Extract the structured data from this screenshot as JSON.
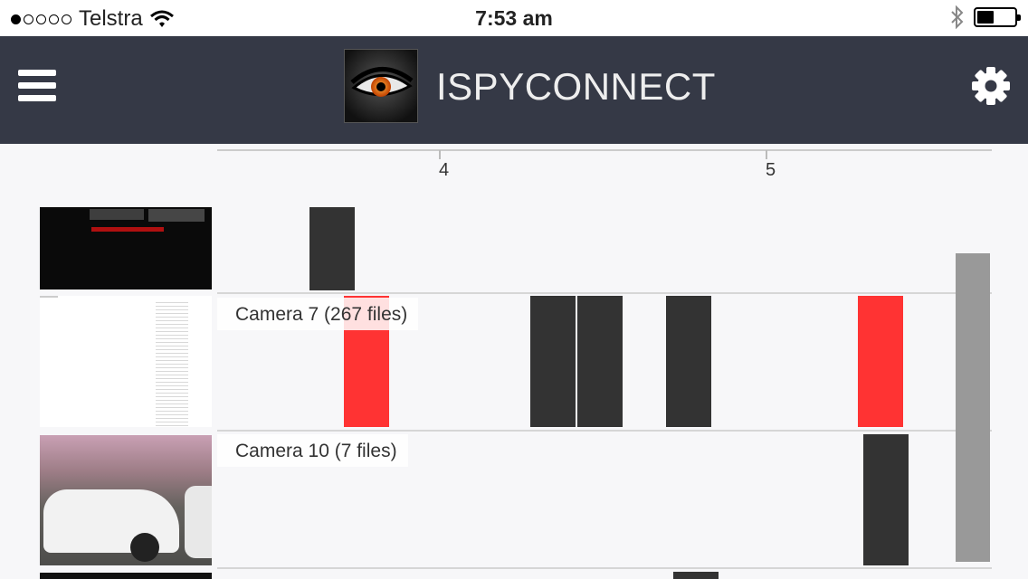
{
  "status_bar": {
    "carrier": "Telstra",
    "signal_bars_filled": 1,
    "signal_bars_total": 5,
    "time": "7:53 am",
    "battery_level": 0.45
  },
  "header": {
    "title": "ISPYCONNECT",
    "menu_icon": "hamburger-menu-icon",
    "settings_icon": "gear-icon",
    "background_color": "#353946"
  },
  "timeline": {
    "axis_ticks": [
      "4",
      "5"
    ],
    "rows": [
      {
        "label": "",
        "thumbnail": "dark-camera-feed"
      },
      {
        "label": "Camera 7 (267 files)",
        "thumbnail": "white-document-feed"
      },
      {
        "label": "Camera 10 (7 files)",
        "thumbnail": "parking-lot-white-car"
      }
    ],
    "colors": {
      "event_bar": "#333333",
      "alert_bar": "#ff3333",
      "group_bar": "#999999"
    }
  }
}
